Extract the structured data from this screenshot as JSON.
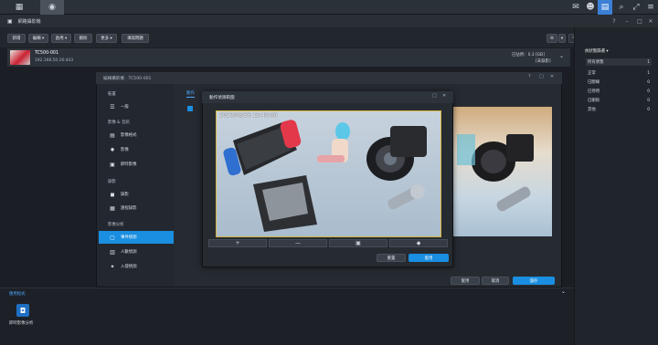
{
  "window": {
    "title": "網路攝影機"
  },
  "toolbar": {
    "new_label": "新增",
    "edit_label": "編輯 ▾",
    "enable_label": "啟用 ▾",
    "delete_label": "刪除",
    "more_label": "更多 ▾",
    "summary_label": "填寫問題",
    "search_placeholder": "搜尋"
  },
  "camera": {
    "name": "TC500-001",
    "ip": "192.168.50.16:443",
    "usage": "已佔用：0.3 [GB]",
    "status": "[未錄影]"
  },
  "sidebar": {
    "header": "依狀態篩選 ▾",
    "items": [
      {
        "label": "所有狀態",
        "count": "1"
      },
      {
        "label": "正常",
        "count": "1"
      },
      {
        "label": "已斷線",
        "count": "0"
      },
      {
        "label": "已停用",
        "count": "0"
      },
      {
        "label": "已刪除",
        "count": "0"
      },
      {
        "label": "其他",
        "count": "0"
      }
    ]
  },
  "settings": {
    "title": "編輯攝影機 - TC500-001",
    "groups": [
      "裝置",
      "影像 & 音訊",
      "錄影",
      "影像分析"
    ],
    "nav": [
      {
        "label": "一般",
        "icon": "☰"
      },
      {
        "label": "影像格式",
        "icon": "▤"
      },
      {
        "label": "影像",
        "icon": "✹"
      },
      {
        "label": "即時影像",
        "icon": "▣"
      },
      {
        "label": "錄影",
        "icon": "◼"
      },
      {
        "label": "遠程錄影",
        "icon": "▦"
      },
      {
        "label": "事件偵測",
        "icon": "▢"
      },
      {
        "label": "人數偵測",
        "icon": "▥"
      },
      {
        "label": "入侵偵測",
        "icon": "✦"
      }
    ],
    "tab_label": "動作",
    "apply_label": "套用",
    "cancel_label": "取消",
    "save_label": "儲存"
  },
  "region": {
    "title": "動作偵測範圍",
    "timestamp": "2023/08/26 15:49:06",
    "tools": [
      "+",
      "—",
      "▣",
      "◆"
    ],
    "reset_label": "重置",
    "apply_label": "套用"
  },
  "apps": {
    "header": "應用程式",
    "item_label": "即時影像分析"
  },
  "colors": {
    "accent": "#1a8ee0",
    "selection": "#d6b540"
  }
}
